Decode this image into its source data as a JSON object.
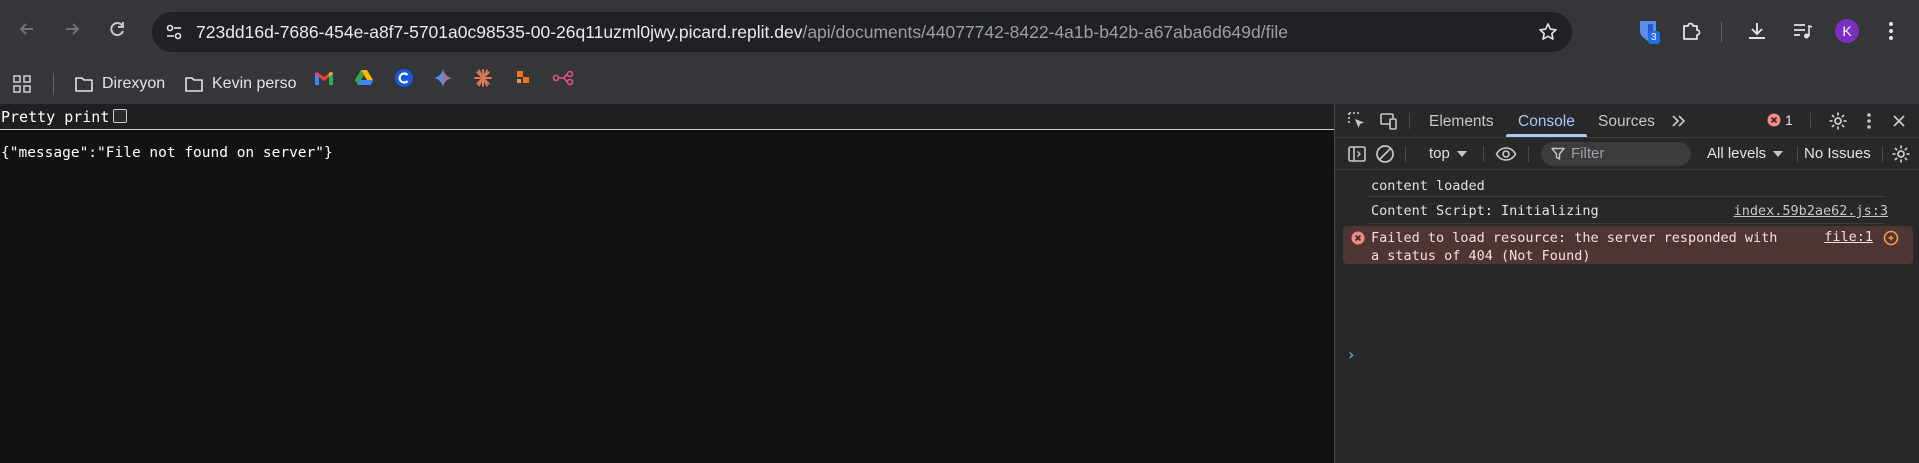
{
  "browser": {
    "url_host": "723dd16d-7686-454e-a8f7-5701a0c98535-00-26q11uzml0jwy.picard.replit.dev",
    "url_path": "/api/documents/44077742-8422-4a1b-b42b-a67aba6d649d/file",
    "extension_badge": "3",
    "profile_initial": "K",
    "icons": {
      "back": "arrow-left-icon",
      "forward": "arrow-right-icon",
      "reload": "reload-icon",
      "site_info": "tune-icon",
      "bookmark": "star-icon",
      "extensions": "puzzle-icon",
      "downloads": "download-icon",
      "media": "media-queue-icon",
      "menu": "kebab-menu-icon"
    }
  },
  "bookmarks": {
    "folders": [
      {
        "label": "Direxyon"
      },
      {
        "label": "Kevin perso"
      }
    ],
    "favicons": [
      "gmail-icon",
      "google-drive-icon",
      "c-logo-icon",
      "gemini-icon",
      "claude-icon",
      "orange-grid-icon",
      "flow-icon"
    ]
  },
  "page": {
    "pretty_print_label": "Pretty print",
    "json_text": "{\"message\":\"File not found on server\"}"
  },
  "devtools": {
    "tabs": [
      "Elements",
      "Console",
      "Sources"
    ],
    "active_tab": "Console",
    "error_count": "1",
    "context": "top",
    "filter_placeholder": "Filter",
    "levels": "All levels",
    "issues": "No Issues",
    "messages": [
      {
        "text": "content loaded",
        "source": ""
      },
      {
        "text": "Content Script: Initializing",
        "source": "index.59b2ae62.js:3"
      }
    ],
    "error": {
      "text_line1": "Failed to load resource: the server responded with",
      "text_line2": "a status of 404 (Not Found)",
      "source": "file:1"
    },
    "colors": {
      "accent": "#a8c7fa",
      "error_bg": "#4e3534",
      "error_icon": "#f28b82"
    }
  }
}
